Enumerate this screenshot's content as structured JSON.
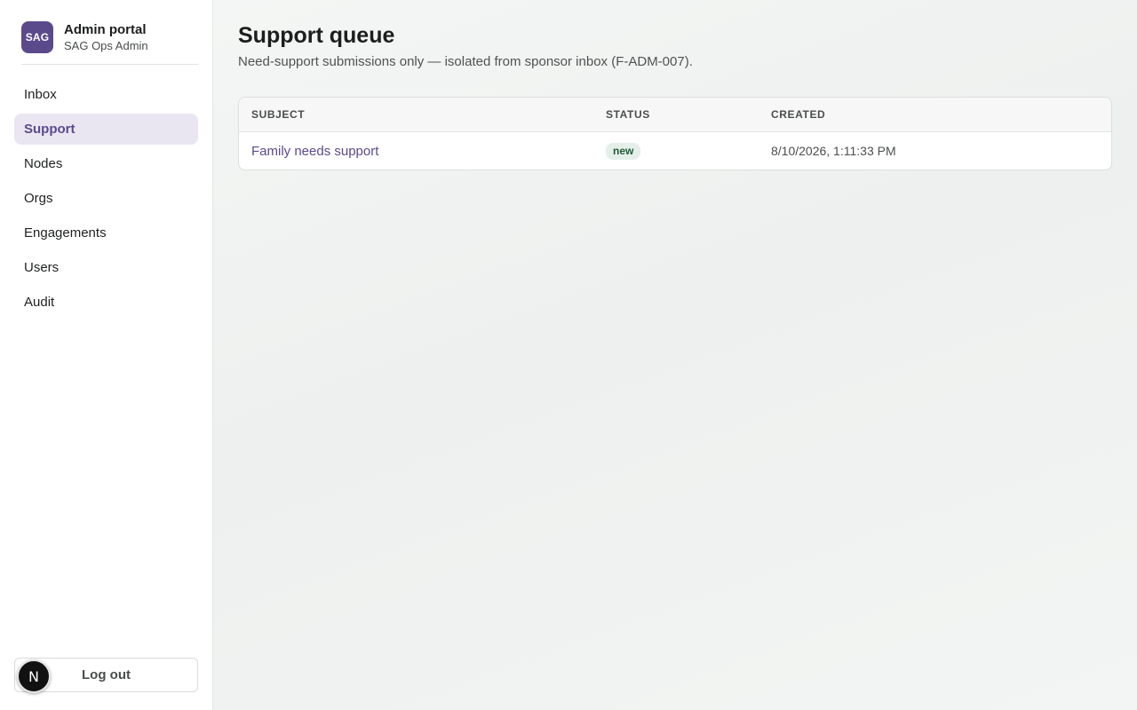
{
  "brand": {
    "logo_text": "SAG",
    "title": "Admin portal",
    "subtitle": "SAG Ops Admin"
  },
  "nav": {
    "items": [
      {
        "label": "Inbox",
        "active": false
      },
      {
        "label": "Support",
        "active": true
      },
      {
        "label": "Nodes",
        "active": false
      },
      {
        "label": "Orgs",
        "active": false
      },
      {
        "label": "Engagements",
        "active": false
      },
      {
        "label": "Users",
        "active": false
      },
      {
        "label": "Audit",
        "active": false
      }
    ]
  },
  "logout_label": "Log out",
  "dev_badge_letter": "N",
  "page": {
    "title": "Support queue",
    "subtitle": "Need-support submissions only — isolated from sponsor inbox (F-ADM-007)."
  },
  "table": {
    "headers": {
      "subject": "SUBJECT",
      "status": "STATUS",
      "created": "CREATED"
    },
    "rows": [
      {
        "subject": "Family needs support",
        "status": "new",
        "created": "8/10/2026, 1:11:33 PM"
      }
    ]
  },
  "colors": {
    "accent": "#5b4a8b",
    "active_nav_bg": "#e9e6f2",
    "status_new_bg": "#e5efe9",
    "status_new_text": "#1f5b3a"
  }
}
